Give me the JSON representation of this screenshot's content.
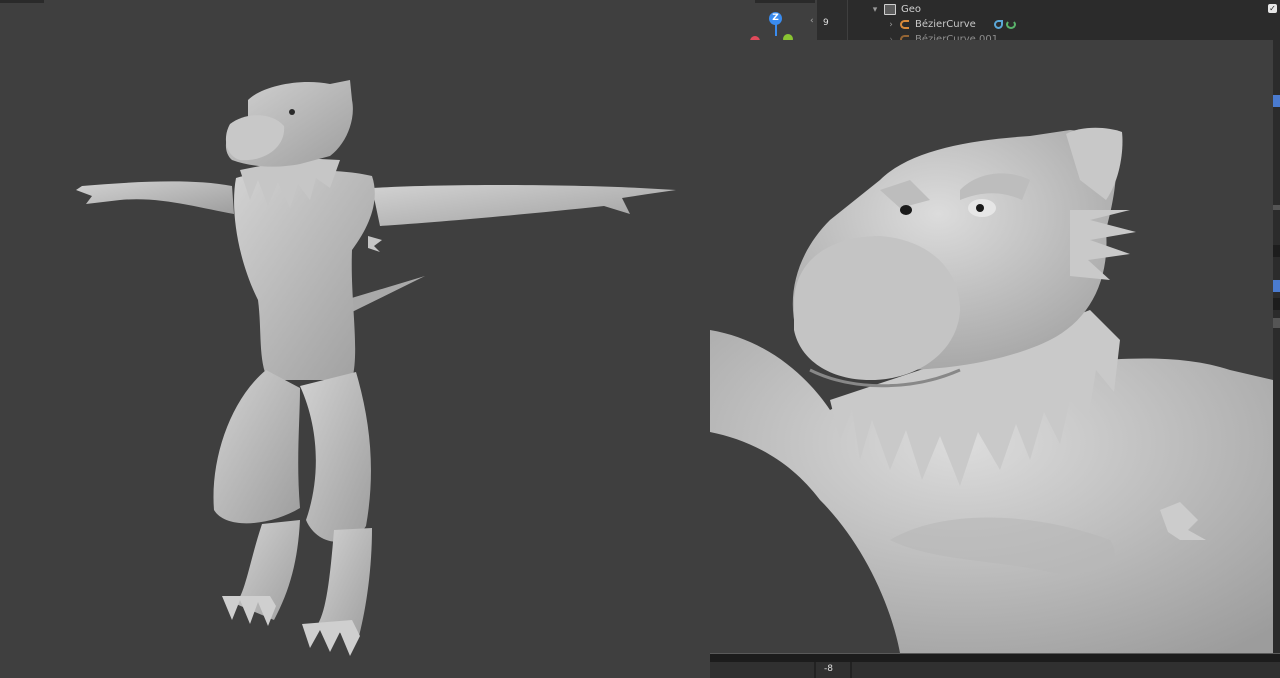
{
  "outliner": {
    "collection_label": "Geo",
    "items": [
      {
        "label": "BézierCurve",
        "icon": "curve-icon"
      },
      {
        "label": "BézierCurve.001",
        "icon": "curve-icon"
      }
    ],
    "collection_checked": true
  },
  "viewport": {
    "gizmo": {
      "z_label": "Z",
      "x_color": "#e04a5b",
      "y_color": "#8ac432",
      "z_color": "#3a8cf0"
    },
    "frame_top_number": "9",
    "frame_bottom_number": "-8"
  },
  "colors": {
    "viewport_bg": "#3f3f3f",
    "mesh": "#bdbdbd",
    "selection_accent": "#4a7bd0"
  },
  "scene": {
    "left_model": "character-full-body-tpose",
    "right_model": "character-head-closeup"
  }
}
